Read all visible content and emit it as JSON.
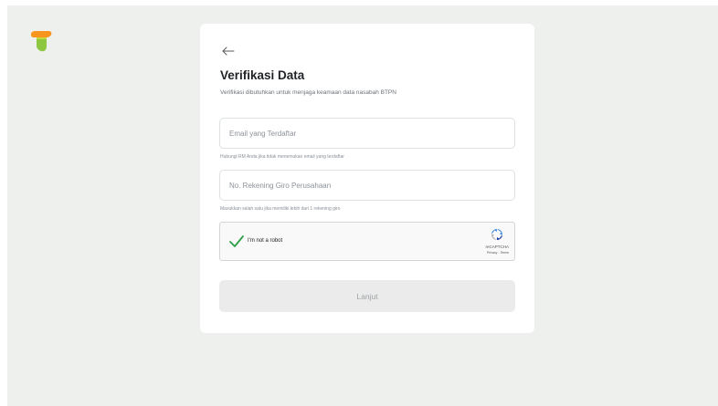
{
  "brand": {
    "logo_icon": "btpn-logo-icon",
    "colors": {
      "orange": "#f7941d",
      "green": "#8dc63f",
      "accent": "#c7d93b"
    }
  },
  "form": {
    "title": "Verifikasi Data",
    "subtitle": "Verifikasi dibutuhkan untuk menjaga keamaan data nasabah BTPN",
    "email": {
      "placeholder": "Email yang Terdaftar",
      "value": "",
      "hint": "Hubungi RM Anda jika tidak menemukan email yang terdaftar"
    },
    "account": {
      "placeholder": "No. Rekening Giro Perusahaan",
      "value": "",
      "hint": "Masukkan salah satu jika memiliki lebih dari 1 rekening giro"
    },
    "captcha": {
      "label": "I'm not a robot",
      "checked": true,
      "brand": "reCAPTCHA",
      "terms": "Privacy - Terms"
    },
    "submit_label": "Lanjut"
  }
}
